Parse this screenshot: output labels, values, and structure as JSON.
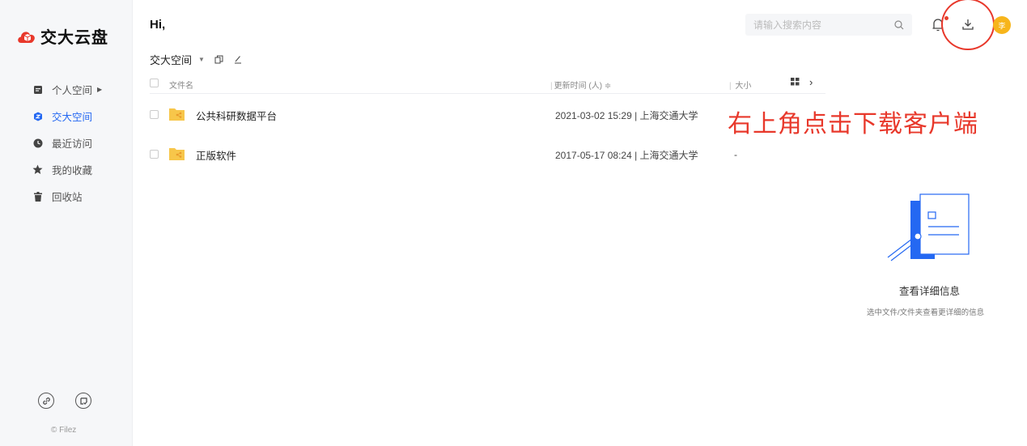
{
  "app": {
    "name": "交大云盘",
    "copyright": "© Filez",
    "colors": {
      "accent": "#2468f2",
      "logo_red": "#e8382b",
      "folder": "#f7c64a",
      "avatar": "#f7b51b",
      "annotation": "#e8382b"
    }
  },
  "sidebar": {
    "items": [
      {
        "label": "个人空间",
        "icon": "document-icon",
        "has_caret": true
      },
      {
        "label": "交大空间",
        "icon": "shield-icon",
        "active": true
      },
      {
        "label": "最近访问",
        "icon": "clock-icon"
      },
      {
        "label": "我的收藏",
        "icon": "star-icon"
      },
      {
        "label": "回收站",
        "icon": "trash-icon"
      }
    ],
    "footer_icons": [
      "link-icon",
      "task-icon"
    ]
  },
  "header": {
    "greeting": "Hi,",
    "search_placeholder": "请输入搜索内容",
    "avatar_text": "李"
  },
  "toolbar": {
    "space_name": "交大空间"
  },
  "table": {
    "headers": {
      "name": "文件名",
      "time": "更新时间 (人)",
      "size": "大小"
    },
    "rows": [
      {
        "name": "公共科研数据平台",
        "meta": "2021-03-02 15:29 | 上海交通大学",
        "size": ""
      },
      {
        "name": "正版软件",
        "meta": "2017-05-17 08:24 | 上海交通大学",
        "size": "-"
      }
    ]
  },
  "annotation": "右上角点击下载客户端",
  "detail": {
    "title": "查看详细信息",
    "subtitle": "选中文件/文件夹查看更详细的信息"
  }
}
